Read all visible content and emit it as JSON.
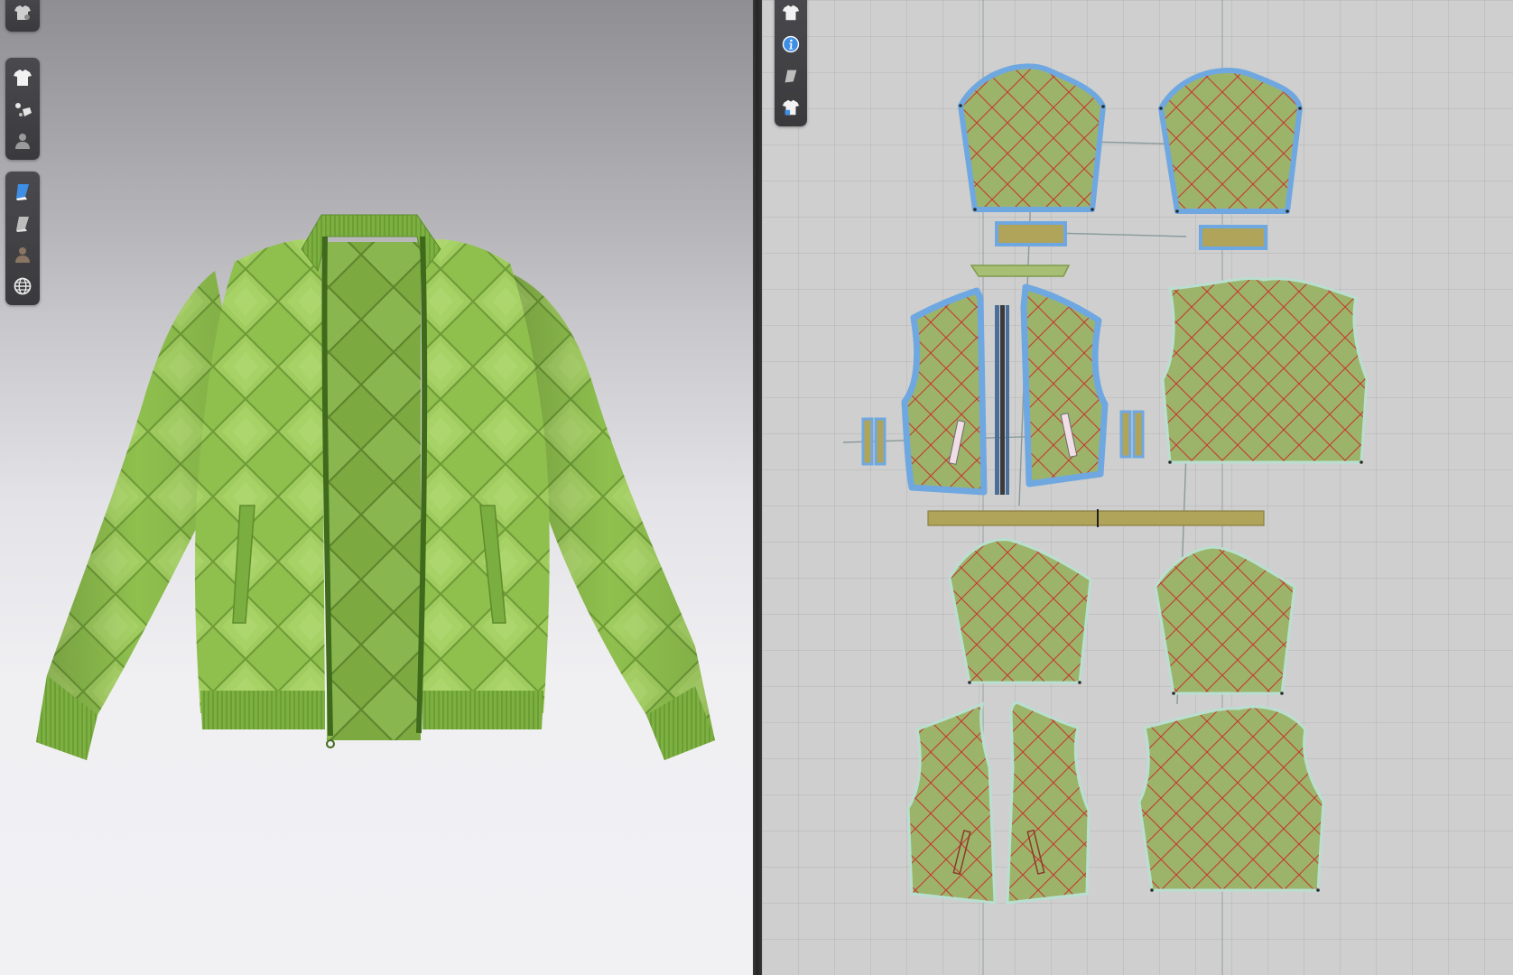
{
  "app": {
    "accent_color": "#3f8ee6",
    "fabric_color": "#8fc04e",
    "pattern_fill_color": "#9cb46a",
    "quilt_line_color": "#c4392f",
    "seam_highlight_color": "#6fa8e0",
    "trim_color": "#b0a45a"
  },
  "toolbar3d": {
    "group_top": [
      {
        "name": "garment-avatar-icon",
        "active": false
      }
    ],
    "group_mid": [
      {
        "name": "garment-tshirt-icon",
        "active": false
      },
      {
        "name": "fitting-tool-icon",
        "active": false
      },
      {
        "name": "avatar-silhouette-icon",
        "active": false
      }
    ],
    "group_bottom": [
      {
        "name": "texture-surface-icon",
        "active": true
      },
      {
        "name": "surface-shading-icon",
        "active": false
      },
      {
        "name": "avatar-skin-icon",
        "active": false
      },
      {
        "name": "globe-environment-icon",
        "active": false
      }
    ]
  },
  "toolbar2d": {
    "items": [
      {
        "name": "pattern-garment-icon",
        "active": false
      },
      {
        "name": "info-icon",
        "active": true
      },
      {
        "name": "eraser-shape-icon",
        "active": false
      },
      {
        "name": "garment-settings-icon",
        "active": false
      }
    ]
  }
}
